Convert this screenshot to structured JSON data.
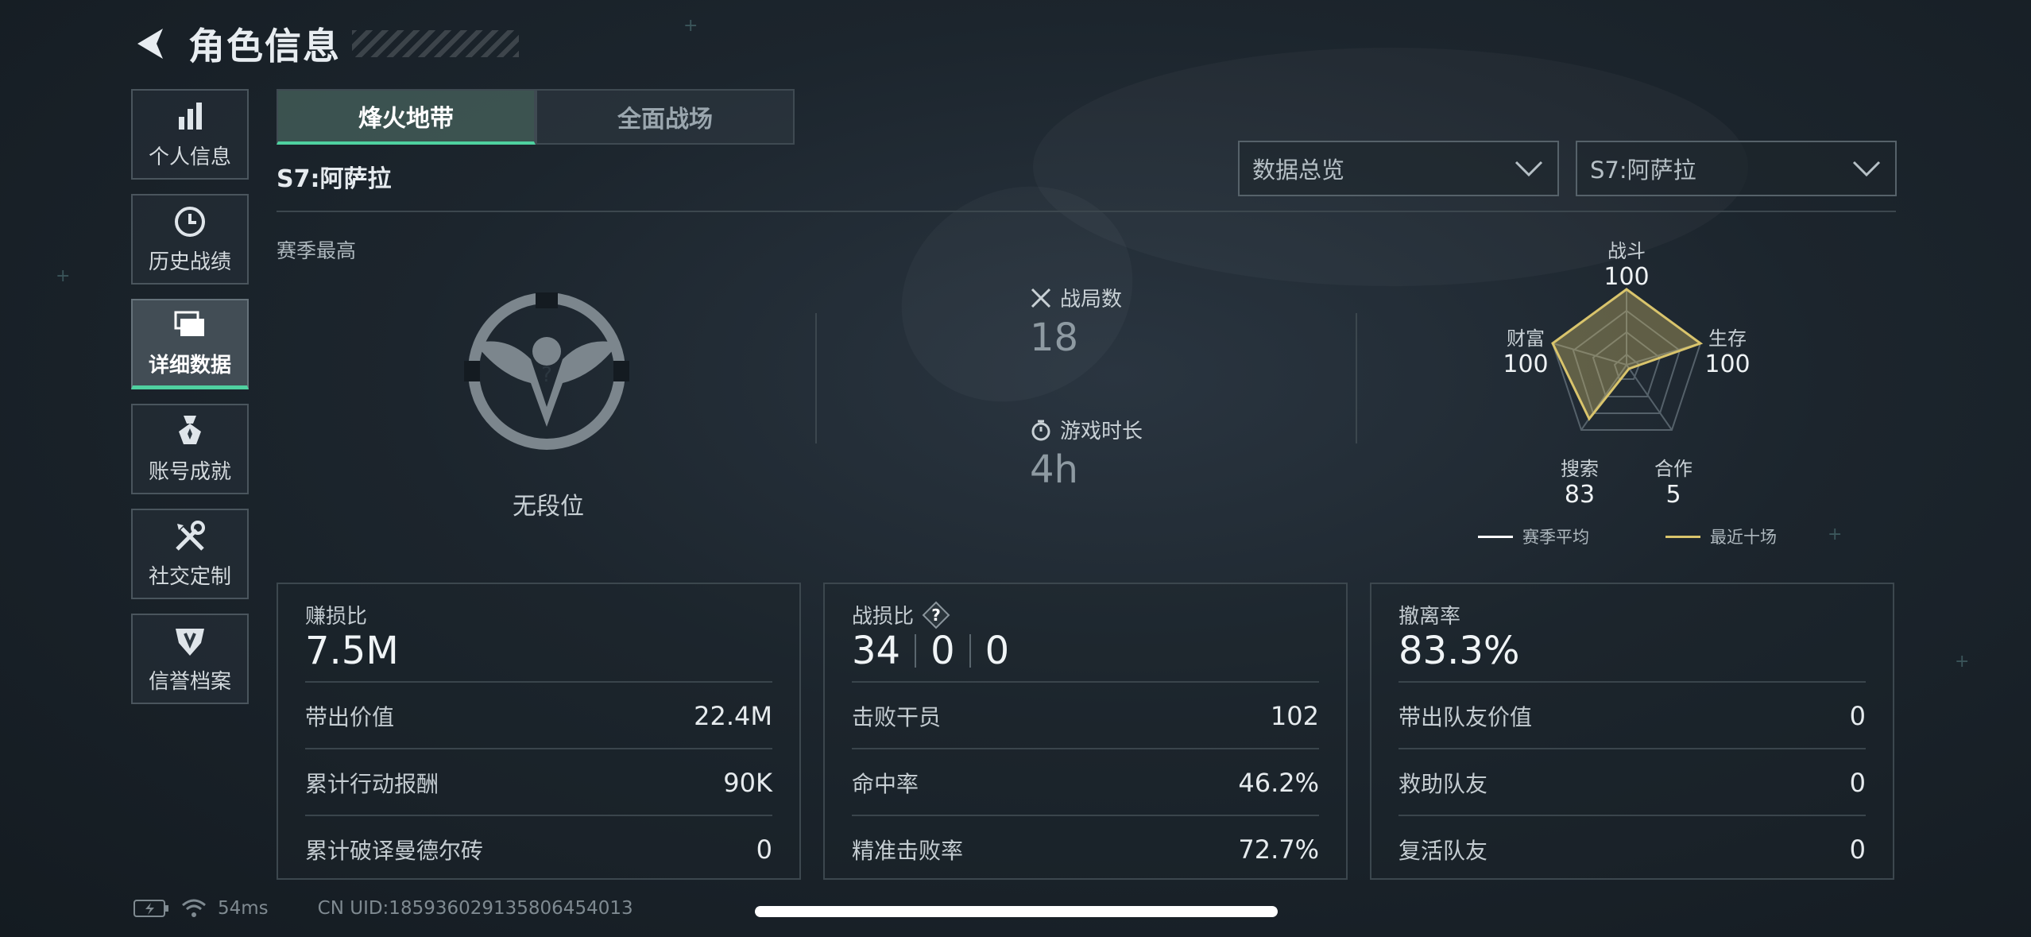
{
  "header": {
    "title": "角色信息"
  },
  "sidebar": {
    "items": [
      {
        "label": "个人信息",
        "icon": "bar-chart-icon"
      },
      {
        "label": "历史战绩",
        "icon": "history-clock-icon"
      },
      {
        "label": "详细数据",
        "icon": "folder-icon",
        "active": true
      },
      {
        "label": "账号成就",
        "icon": "medal-icon"
      },
      {
        "label": "社交定制",
        "icon": "tools-icon"
      },
      {
        "label": "信誉档案",
        "icon": "shield-icon"
      }
    ]
  },
  "tabs": [
    {
      "label": "烽火地带",
      "active": true
    },
    {
      "label": "全面战场",
      "active": false
    }
  ],
  "season_label": "S7:阿萨拉",
  "dropdowns": {
    "view": "数据总览",
    "season": "S7:阿萨拉"
  },
  "summary": {
    "season_best_label": "赛季最高",
    "rank": "无段位",
    "matches_label": "战局数",
    "matches_value": "18",
    "playtime_label": "游戏时长",
    "playtime_value": "4h"
  },
  "radar": {
    "axes": [
      {
        "label": "战斗",
        "value": "100"
      },
      {
        "label": "生存",
        "value": "100"
      },
      {
        "label": "合作",
        "value": "5"
      },
      {
        "label": "搜索",
        "value": "83"
      },
      {
        "label": "财富",
        "value": "100"
      }
    ],
    "legend_avg": "赛季平均",
    "legend_recent": "最近十场",
    "colors": {
      "avg": "#ffffff",
      "recent": "#d9c46c"
    }
  },
  "cards": {
    "profit": {
      "title": "赚损比",
      "main": "7.5M",
      "rows": [
        {
          "label": "带出价值",
          "value": "22.4M"
        },
        {
          "label": "累计行动报酬",
          "value": "90K"
        },
        {
          "label": "累计破译曼德尔砖",
          "value": "0"
        }
      ]
    },
    "combat": {
      "title": "战损比",
      "kd": [
        "34",
        "0",
        "0"
      ],
      "rows": [
        {
          "label": "击败干员",
          "value": "102"
        },
        {
          "label": "命中率",
          "value": "46.2%"
        },
        {
          "label": "精准击败率",
          "value": "72.7%"
        }
      ]
    },
    "extract": {
      "title": "撤离率",
      "main": "83.3%",
      "rows": [
        {
          "label": "带出队友价值",
          "value": "0"
        },
        {
          "label": "救助队友",
          "value": "0"
        },
        {
          "label": "复活队友",
          "value": "0"
        }
      ]
    }
  },
  "footer": {
    "ping": "54ms",
    "uid": "CN UID:1859360291358064540​13"
  },
  "accent_color": "#4fd1a0"
}
